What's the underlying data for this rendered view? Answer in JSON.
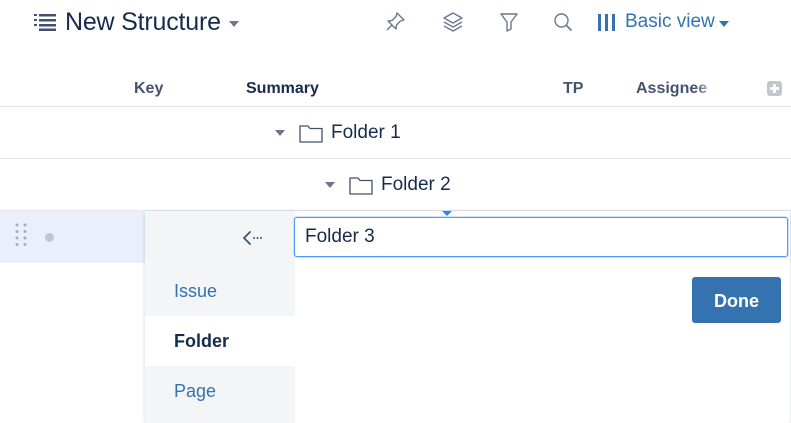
{
  "toolbar": {
    "structure_title": "New Structure",
    "title_icon": "structure-list-icon",
    "tools": [
      "pin-icon",
      "layers-icon",
      "filter-icon",
      "search-icon"
    ],
    "view_label": "Basic view",
    "view_icon": "columns-icon",
    "accent_color": "#3572b0"
  },
  "columns": {
    "key": "Key",
    "summary": "Summary",
    "tp": "TP",
    "assignee": "Assignee",
    "add_icon": "add-column-icon"
  },
  "rows": [
    {
      "label": "Folder 1",
      "type": "folder",
      "expanded": true
    },
    {
      "label": "Folder 2",
      "type": "folder",
      "expanded": true
    }
  ],
  "new_item": {
    "name_value": "Folder 3",
    "back_icon": "back-arrow-icon",
    "types": [
      "Issue",
      "Folder",
      "Page"
    ],
    "selected_type": "Folder",
    "done_label": "Done"
  }
}
